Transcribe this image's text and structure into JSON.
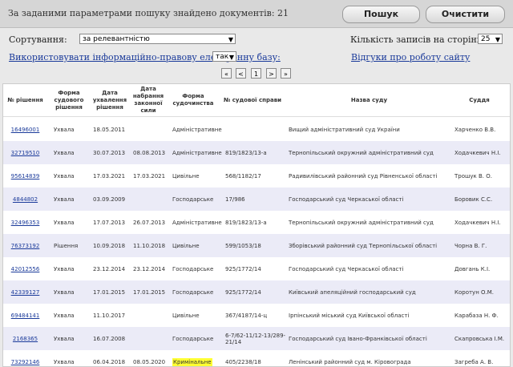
{
  "header": {
    "found_text": "За заданими параметрами пошуку знайдено документів: 21",
    "search_label": "Пошук",
    "clear_label": "Очистити"
  },
  "controls": {
    "sort_label": "Сортування:",
    "sort_value": "за релевантністю",
    "per_page_label": "Кількість записів на сторінці:",
    "per_page_value": "25",
    "use_base_link": "Використовувати інформаційно-правову електронну базу:",
    "use_base_value": "так",
    "feedback_link": "Відгуки про роботу сайту"
  },
  "pager": [
    "«",
    "<",
    "1",
    ">",
    "»"
  ],
  "table": {
    "headers": [
      "№ рішення",
      "Форма судового рішення",
      "Дата ухвалення рішення",
      "Дата набрання законної сили",
      "Форма судочинства",
      "№ судової справи",
      "Назва суду",
      "Суддя"
    ],
    "rows": [
      [
        "16496001",
        "Ухвала",
        "18.05.2011",
        "",
        "Адміністративне",
        "",
        "Вищий адміністративний суд України",
        "Харченко В.В."
      ],
      [
        "32719510",
        "Ухвала",
        "30.07.2013",
        "08.08.2013",
        "Адміністративне",
        "819/1823/13-а",
        "Тернопільський окружний адміністративний суд",
        "Ходачкевич Н.І."
      ],
      [
        "95614839",
        "Ухвала",
        "17.03.2021",
        "17.03.2021",
        "Цивільне",
        "568/1182/17",
        "Радивилівський районний суд Рівненської області",
        "Трошук В. О."
      ],
      [
        "4844802",
        "Ухвала",
        "03.09.2009",
        "",
        "Господарське",
        "17/986",
        "Господарський суд Черкаської області",
        "Боровик С.С."
      ],
      [
        "32496353",
        "Ухвала",
        "17.07.2013",
        "26.07.2013",
        "Адміністративне",
        "819/1823/13-а",
        "Тернопільський окружний адміністративний суд",
        "Ходачкевич Н.І."
      ],
      [
        "76373192",
        "Рішення",
        "10.09.2018",
        "11.10.2018",
        "Цивільне",
        "599/1053/18",
        "Зборівський районний суд Тернопільської області",
        "Чорна В. Г."
      ],
      [
        "42012556",
        "Ухвала",
        "23.12.2014",
        "23.12.2014",
        "Господарське",
        "925/1772/14",
        "Господарський суд Черкаської області",
        "Довгань К.І."
      ],
      [
        "42339127",
        "Ухвала",
        "17.01.2015",
        "17.01.2015",
        "Господарське",
        "925/1772/14",
        "Київський апеляційний господарський суд",
        "Коротун О.М."
      ],
      [
        "69484141",
        "Ухвала",
        "11.10.2017",
        "",
        "Цивільне",
        "367/4187/14-ц",
        "Ірпінський міський суд Київської області",
        "Карабаза Н. Ф."
      ],
      [
        "2168365",
        "Ухвала",
        "16.07.2008",
        "",
        "Господарське",
        "6-7/62-11/12-13/289-21/14",
        "Господарський суд Івано-Франківської області",
        "Скапровська І.М."
      ],
      [
        "73292146",
        "Ухвала",
        "06.04.2018",
        "08.05.2020",
        "Кримінальне",
        "405/2238/18",
        "Ленінський районний суд м. Кіровограда",
        "Загреба А. В."
      ]
    ]
  }
}
